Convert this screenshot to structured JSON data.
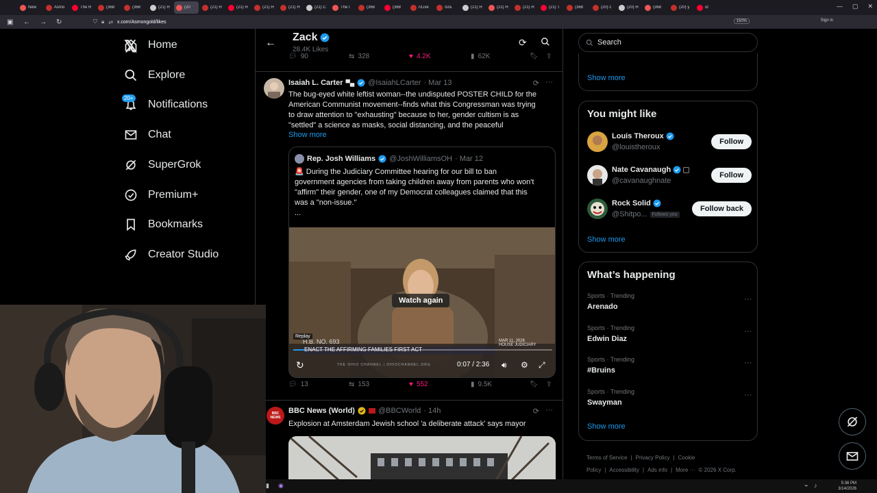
{
  "browser": {
    "tabs": [
      "New",
      "Asmo",
      "The R",
      "(368",
      "(368",
      "(21) H",
      "(20",
      "(21) H",
      "(21) H",
      "(21) H",
      "(21) H",
      "(21) C",
      "The I",
      "(368",
      "(368",
      "r/Live",
      "Isra",
      "(21) H",
      "(21) H",
      "(21) H",
      "(21) T",
      "(368",
      "(20) c",
      "(20) H",
      "(368",
      "(20) y",
      "ol"
    ],
    "url": "x.com/Asmongold/likes",
    "zoom": "150%",
    "signin": "Sign in"
  },
  "nav": {
    "items": [
      "Home",
      "Explore",
      "Notifications",
      "Chat",
      "SuperGrok",
      "Premium+",
      "Bookmarks",
      "Creator Studio"
    ],
    "notif_badge": "20+"
  },
  "header": {
    "name": "Zack",
    "likes": "28.4K Likes"
  },
  "top_actions": {
    "replies": "90",
    "reposts": "328",
    "likes": "4.2K",
    "views": "62K"
  },
  "tweet1": {
    "name": "Isaiah L. Carter",
    "handle": "@IsaiahLCarter",
    "date": "· Mar 13",
    "lines": [
      "The bug-eyed white leftist woman--the undisputed POSTER CHILD for the",
      "American Communist movement--finds what this Congressman was trying",
      "to draw attention to \"exhausting\" because to her, gender cultism is as",
      "\"settled\" a science as masks, social distancing, and the peaceful"
    ],
    "show_more": "Show more",
    "quote": {
      "name": "Rep. Josh Williams",
      "handle": "@JoshWilliamsOH",
      "date": "· Mar 12",
      "lines": [
        "🚨 During the Judiciary Committee hearing for our bill to ban",
        "government agencies from taking children away from parents who won't",
        "\"affirm\" their gender, one of my Democrat colleagues claimed that this",
        "was a \"non-issue.\"",
        "..."
      ],
      "video": {
        "watch_again": "Watch again",
        "replay_tip": "Replay",
        "time": "0:07 / 2:36",
        "progress": 0.045,
        "chyron_number": "H.B. NO. 693",
        "chyron_title": "ENACT THE AFFIRMING FAMILIES FIRST ACT",
        "chyron_date": "MAR 11, 2026",
        "chyron_sub": "HOUSE JUDICIARY",
        "watermark": "THE OHIO CHANNEL | OHIOCHANNEL.ORG"
      }
    },
    "actions": {
      "replies": "13",
      "reposts": "153",
      "likes": "552",
      "views": "9.5K"
    }
  },
  "tweet2": {
    "name": "BBC News (World)",
    "handle": "@BBCWorld",
    "date": "· 14h",
    "text": "Explosion at Amsterdam Jewish school 'a deliberate attack' says mayor",
    "avatar_text": [
      "BBC",
      "NEWS"
    ]
  },
  "right": {
    "search_placeholder": "Search",
    "show_more": "Show more",
    "might_like_title": "You might like",
    "suggestions": [
      {
        "name": "Louis Theroux",
        "handle": "@louistheroux",
        "button": "Follow"
      },
      {
        "name": "Nate Cavanaugh",
        "handle": "@cavanaughnate",
        "button": "Follow"
      },
      {
        "name": "Rock Solid",
        "handle": "@Shitpo...",
        "follows_you": "Follows you",
        "button": "Follow back"
      }
    ],
    "happening_title": "What’s happening",
    "trends": [
      {
        "category": "Sports · Trending",
        "name": "Arenado"
      },
      {
        "category": "Sports · Trending",
        "name": "Edwin Diaz"
      },
      {
        "category": "Sports · Trending",
        "name": "#Bruins"
      },
      {
        "category": "Sports · Trending",
        "name": "Swayman"
      }
    ],
    "footer": [
      "Terms of Service",
      "|",
      "Privacy Policy",
      "|",
      "Cookie Policy",
      "|",
      "Accessibility",
      "|",
      "Ads info",
      "|",
      "More ···",
      "© 2026 X Corp."
    ]
  },
  "taskbar": {
    "time": "5:36 PM",
    "date": "3/14/2026"
  },
  "colors": {
    "accent": "#1d9bf0",
    "like": "#f91880",
    "text": "#e7e9ea",
    "muted": "#71767b",
    "border": "#2f3336"
  }
}
